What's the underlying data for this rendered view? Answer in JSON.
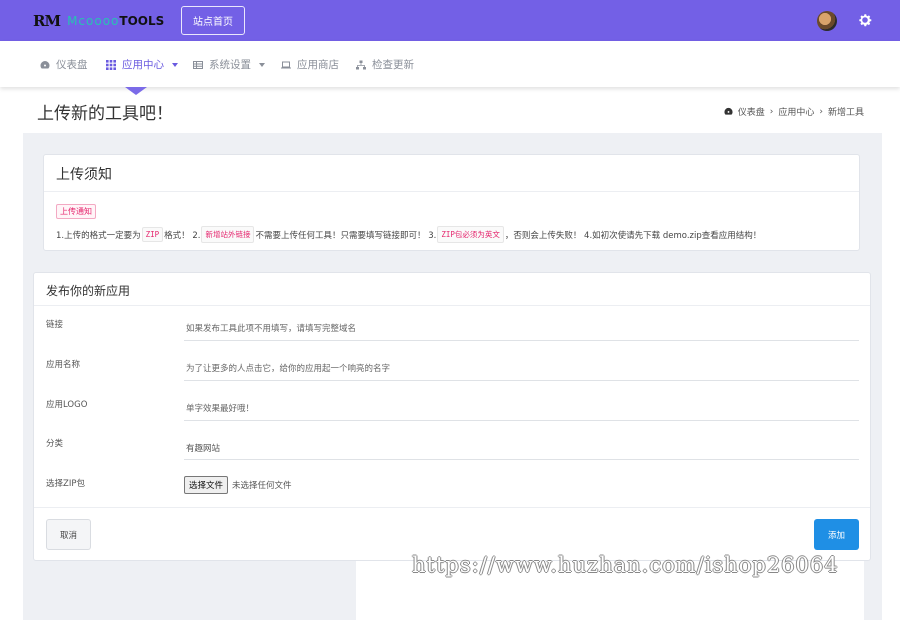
{
  "brand": {
    "mark": "RM",
    "word": "Mcoooo",
    "tools": "TOOLS"
  },
  "header": {
    "home_button": "站点首页"
  },
  "nav": {
    "items": [
      {
        "label": "仪表盘",
        "icon": "dashboard-icon"
      },
      {
        "label": "应用中心",
        "icon": "grid-icon",
        "active": true,
        "dropdown": true
      },
      {
        "label": "系统设置",
        "icon": "table-icon",
        "dropdown": true
      },
      {
        "label": "应用商店",
        "icon": "laptop-icon"
      },
      {
        "label": "检查更新",
        "icon": "sitemap-icon"
      }
    ]
  },
  "page": {
    "title": "上传新的工具吧！",
    "breadcrumb": [
      "仪表盘",
      "应用中心",
      "新增工具"
    ]
  },
  "notice_card": {
    "title": "上传须知",
    "tag": "上传通知",
    "line": {
      "t1": "1.上传的格式一定要为",
      "c1": "ZIP",
      "t2": "格式！ 2.",
      "c2": "新增站外链接",
      "t3": "不需要上传任何工具！只需要填写链接即可！ 3.",
      "c3": "ZIP包必须为英文",
      "t4": "，否则会上传失败！ 4.如初次使请先下载 demo.zip查看应用结构！"
    }
  },
  "form_card": {
    "title": "发布你的新应用",
    "fields": [
      {
        "label": "链接",
        "placeholder": "如果发布工具此项不用填写，请填写完整域名"
      },
      {
        "label": "应用名称",
        "placeholder": "为了让更多的人点击它，给你的应用起一个响亮的名字"
      },
      {
        "label": "应用LOGO",
        "placeholder": "单字效果最好哦！"
      },
      {
        "label": "分类",
        "value": "有趣网站"
      },
      {
        "label": "选择ZIP包"
      }
    ],
    "file_button": "选择文件",
    "file_status": "未选择任何文件",
    "cancel_label": "取消",
    "add_label": "添加"
  },
  "watermark": "https://www.huzhan.com/ishop26064",
  "colors": {
    "header": "#7360e6",
    "accent": "#6a5ae0",
    "primary_button": "#1f8fe5",
    "code_text": "#e5256d"
  }
}
